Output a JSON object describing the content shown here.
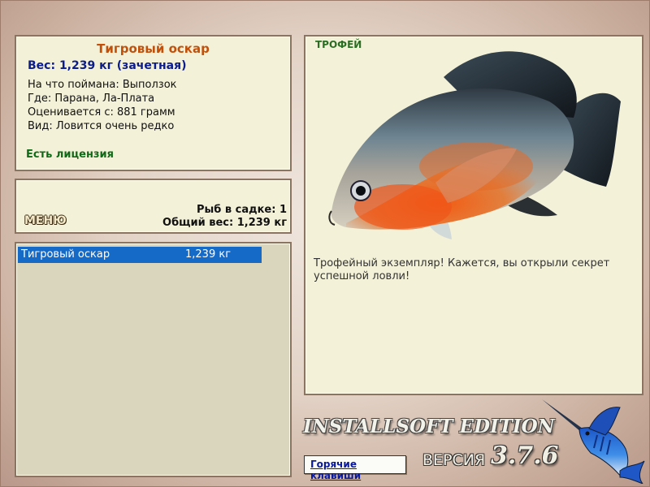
{
  "fish_card": {
    "name": "Тигровый оскар",
    "weight": "Вес: 1,239 кг (зачетная)",
    "lines": [
      "На что поймана: Выползок",
      "Где: Парана, Ла-Плата",
      "Оценивается с: 881 грамм",
      "Вид: Ловится очень редко"
    ],
    "license": "Есть лицензия"
  },
  "menu": {
    "button_label": "МЕНЮ",
    "fish_count": "Рыб в садке: 1",
    "total_weight": "Общий вес: 1,239 кг"
  },
  "catch_list": {
    "rows": [
      {
        "name": "Тигровый оскар",
        "weight": "1,239 кг",
        "selected": true
      }
    ]
  },
  "trophy": {
    "label": "ТРОФЕЙ",
    "message": "Трофейный экземпляр! Кажется, вы открыли секрет успешной ловли!",
    "image": "tiger-oscar-fish"
  },
  "footer": {
    "hotkeys_label": "Горячие клавиши",
    "brand": "INSTALLSOFT EDITION",
    "version_label": "ВЕРСИЯ",
    "version_number": "3.7.6",
    "logo": "marlin-logo"
  },
  "colors": {
    "panel_bg": "#f3f1d8",
    "panel_border": "#8b7462",
    "title_orange": "#c2500b",
    "weight_blue": "#0b1c8c",
    "license_green": "#0f6a17",
    "selection_blue": "#1569c7"
  }
}
